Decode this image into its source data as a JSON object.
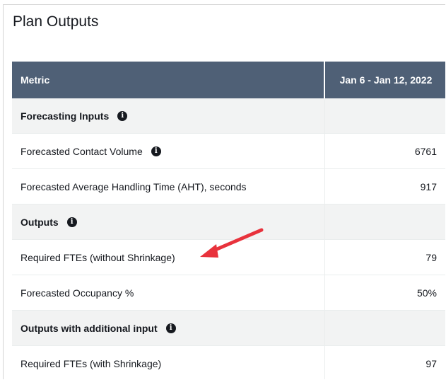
{
  "panel": {
    "title": "Plan Outputs"
  },
  "table": {
    "header": {
      "metric": "Metric",
      "period": "Jan 6 - Jan 12, 2022"
    },
    "rows": [
      {
        "label": "Forecasting Inputs",
        "value": "",
        "section": true,
        "info": true
      },
      {
        "label": "Forecasted Contact Volume",
        "value": "6761",
        "section": false,
        "info": true
      },
      {
        "label": "Forecasted Average Handling Time (AHT), seconds",
        "value": "917",
        "section": false,
        "info": false
      },
      {
        "label": "Outputs",
        "value": "",
        "section": true,
        "info": true
      },
      {
        "label": "Required FTEs (without Shrinkage)",
        "value": "79",
        "section": false,
        "info": false
      },
      {
        "label": "Forecasted Occupancy %",
        "value": "50%",
        "section": false,
        "info": false
      },
      {
        "label": "Outputs with additional input",
        "value": "",
        "section": true,
        "info": true
      },
      {
        "label": "Required FTEs (with Shrinkage)",
        "value": "97",
        "section": false,
        "info": false
      }
    ]
  },
  "annotation": {
    "arrow_color": "#e8323c",
    "points_to": "Required FTEs (without Shrinkage)"
  },
  "colors": {
    "header_bg": "#4f6076",
    "section_bg": "#f2f3f3",
    "text": "#16191f"
  }
}
